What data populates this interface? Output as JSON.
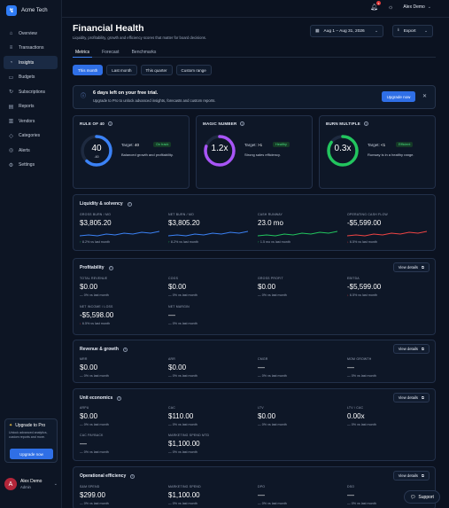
{
  "brand": {
    "name": "Acme Tech"
  },
  "nav": [
    {
      "label": "Overview",
      "icon": "home-icon"
    },
    {
      "label": "Transactions",
      "icon": "list-icon"
    },
    {
      "label": "Insights",
      "icon": "chart-icon",
      "active": true
    },
    {
      "label": "Budgets",
      "icon": "wallet-icon"
    },
    {
      "label": "Subscriptions",
      "icon": "repeat-icon"
    },
    {
      "label": "Reports",
      "icon": "file-icon"
    },
    {
      "label": "Vendors",
      "icon": "store-icon"
    },
    {
      "label": "Categories",
      "icon": "tag-icon"
    },
    {
      "label": "Alerts",
      "icon": "bell-icon"
    },
    {
      "label": "Settings",
      "icon": "gear-icon"
    }
  ],
  "sidebar_upgrade": {
    "title": "Upgrade to Pro",
    "text": "Unlock advanced analytics, custom reports and more.",
    "button": "Upgrade now"
  },
  "user": {
    "initial": "A",
    "name": "Alex Demo",
    "role": "Admin"
  },
  "topbar": {
    "notification_count": "3",
    "user_name": "Alex Demo"
  },
  "page": {
    "title": "Financial Health",
    "subtitle": "Liquidity, profitability, growth and efficiency scores that matter for board decisions.",
    "date_range": "Aug 1 – Aug 31, 2026",
    "export_label": "Export"
  },
  "tabs": [
    "Metrics",
    "Forecast",
    "Benchmarks"
  ],
  "periods": [
    "This month",
    "Last month",
    "This quarter",
    "Custom range"
  ],
  "trial": {
    "title": "6 days left on your free trial.",
    "text": "Upgrade to Pro to unlock advanced insights, forecasts and custom reports.",
    "button": "Upgrade now"
  },
  "scores": [
    {
      "title": "RULE OF 40",
      "value": "40",
      "sub": "-60",
      "target_label": "Target:",
      "target": "40",
      "status": "On track",
      "desc": "Balanced growth and profitability.",
      "ring_color": "#3b82f6",
      "fill": 0.62
    },
    {
      "title": "MAGIC NUMBER",
      "value": "1.2x",
      "sub": "",
      "target_label": "Target:",
      "target": ">1",
      "status": "Healthy",
      "desc": "Strong sales efficiency.",
      "ring_color": "#a855f7",
      "fill": 0.8
    },
    {
      "title": "BURN MULTIPLE",
      "value": "0.3x",
      "sub": "",
      "target_label": "Target:",
      "target": "<1",
      "status": "Efficient",
      "desc": "Runway is in a healthy range.",
      "ring_color": "#22c55e",
      "fill": 0.85
    }
  ],
  "liquidity": {
    "title": "Liquidity & solvency",
    "metrics": [
      {
        "label": "GROSS BURN / MO",
        "value": "$3,805.20",
        "change": "8.2% vs last month",
        "dir": "up",
        "spark": "#3b82f6"
      },
      {
        "label": "NET BURN / MO",
        "value": "$3,805.20",
        "change": "8.2% vs last month",
        "dir": "up",
        "spark": "#3b82f6"
      },
      {
        "label": "CASH RUNWAY",
        "value": "23.0 mo",
        "change": "1.5 mo vs last month",
        "dir": "up",
        "spark": "#22c55e"
      },
      {
        "label": "OPERATING CASH FLOW",
        "value": "-$5,599.00",
        "change": "6.5% vs last month",
        "dir": "down",
        "spark": "#ef4444"
      }
    ]
  },
  "profitability": {
    "title": "Profitability",
    "view": "View details",
    "metrics": [
      {
        "label": "TOTAL REVENUE",
        "value": "$0.00",
        "change": "0% vs last month",
        "dir": "flat"
      },
      {
        "label": "COGS",
        "value": "$0.00",
        "change": "0% vs last month",
        "dir": "flat"
      },
      {
        "label": "GROSS PROFIT",
        "value": "$0.00",
        "change": "0% vs last month",
        "dir": "flat"
      },
      {
        "label": "EBITDA",
        "value": "-$5,599.00",
        "change": "6.5% vs last month",
        "dir": "down"
      },
      {
        "label": "NET INCOME / LOSS",
        "value": "-$5,598.00",
        "change": "6.5% vs last month",
        "dir": "down"
      },
      {
        "label": "NET MARGIN",
        "value": "—",
        "change": "0% vs last month",
        "dir": "flat"
      }
    ]
  },
  "revenue": {
    "title": "Revenue & growth",
    "view": "View details",
    "metrics": [
      {
        "label": "MRR",
        "value": "$0.00",
        "change": "0% vs last month",
        "dir": "flat"
      },
      {
        "label": "ARR",
        "value": "$0.00",
        "change": "0% vs last month",
        "dir": "flat"
      },
      {
        "label": "CMGR",
        "value": "—",
        "change": "0% vs last month",
        "dir": "flat"
      },
      {
        "label": "MOM GROWTH",
        "value": "—",
        "change": "0% vs last month",
        "dir": "flat"
      }
    ]
  },
  "unit": {
    "title": "Unit economics",
    "view": "View details",
    "metrics": [
      {
        "label": "ARPU",
        "value": "$0.00",
        "change": "0% vs last month",
        "dir": "flat"
      },
      {
        "label": "CAC",
        "value": "$110.00",
        "change": "0% vs last month",
        "dir": "flat"
      },
      {
        "label": "LTV",
        "value": "$0.00",
        "change": "0% vs last month",
        "dir": "flat"
      },
      {
        "label": "LTV / CAC",
        "value": "0.00x",
        "change": "0% vs last month",
        "dir": "flat"
      },
      {
        "label": "CAC PAYBACK",
        "value": "—",
        "change": "0% vs last month",
        "dir": "flat"
      },
      {
        "label": "MARKETING SPEND MTD",
        "value": "$1,100.00",
        "change": "0% vs last month",
        "dir": "flat"
      }
    ]
  },
  "operational": {
    "title": "Operational efficiency",
    "view": "View details",
    "metrics": [
      {
        "label": "S&M SPEND",
        "value": "$299.00",
        "change": "0% vs last month",
        "dir": "flat"
      },
      {
        "label": "MARKETING SPEND",
        "value": "$1,100.00",
        "change": "0% vs last month",
        "dir": "flat"
      },
      {
        "label": "DPO",
        "value": "—",
        "change": "0% vs last month",
        "dir": "flat"
      },
      {
        "label": "DSO",
        "value": "—",
        "change": "0% vs last month",
        "dir": "flat"
      }
    ]
  },
  "support": {
    "label": "Support"
  }
}
